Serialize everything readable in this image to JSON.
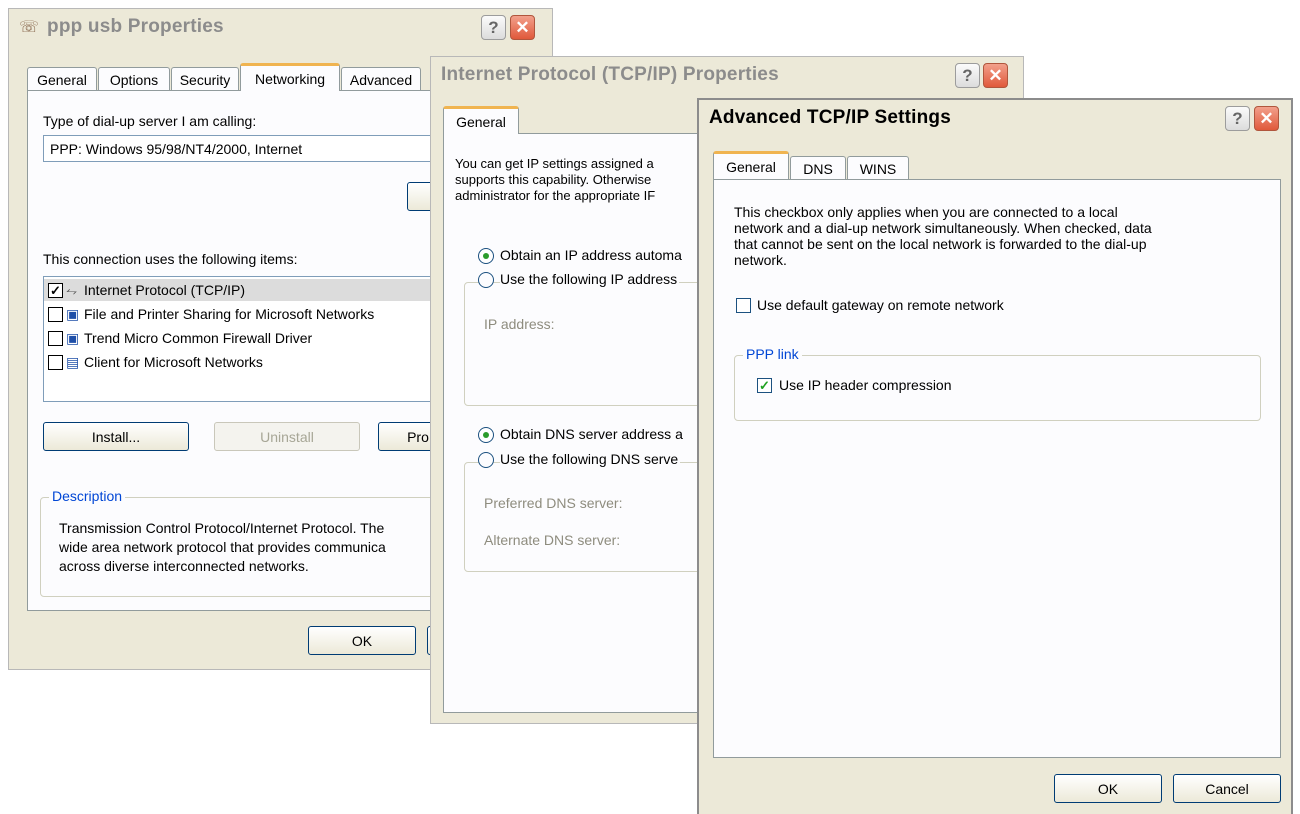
{
  "ppp_dialog": {
    "title": "ppp usb Properties",
    "tabs": [
      "General",
      "Options",
      "Security",
      "Networking",
      "Advanced"
    ],
    "active_tab": "Networking",
    "server_type_label": "Type of dial-up server I am calling:",
    "server_type_value": "PPP: Windows 95/98/NT4/2000, Internet",
    "items_label": "This connection uses the following items:",
    "items": [
      {
        "label": "Internet Protocol (TCP/IP)",
        "checked": true,
        "icon": "network-protocol-icon",
        "selected": true
      },
      {
        "label": "File and Printer Sharing for Microsoft Networks",
        "checked": false,
        "icon": "computer-icon"
      },
      {
        "label": "Trend Micro Common Firewall Driver",
        "checked": false,
        "icon": "computer-icon"
      },
      {
        "label": "Client for Microsoft Networks",
        "checked": false,
        "icon": "monitor-icon"
      }
    ],
    "install_label": "Install...",
    "uninstall_label": "Uninstall",
    "properties_label": "Pro",
    "description_legend": "Description",
    "description_lines": [
      "Transmission Control Protocol/Internet Protocol. The",
      "wide area network protocol that provides communica",
      "across diverse interconnected networks."
    ],
    "ok_label": "OK"
  },
  "tcpip_dialog": {
    "title": "Internet Protocol (TCP/IP) Properties",
    "tab": "General",
    "intro_lines": [
      "You can get IP settings assigned a",
      "supports this capability. Otherwise",
      "administrator for the appropriate IF"
    ],
    "obtain_ip_label": "Obtain an IP address automa",
    "use_ip_label": "Use the following IP address",
    "ip_address_label": "IP address:",
    "obtain_dns_label": "Obtain DNS server address a",
    "use_dns_label": "Use the following DNS serve",
    "preferred_dns_label": "Preferred DNS server:",
    "alternate_dns_label": "Alternate DNS server:"
  },
  "advanced_dialog": {
    "title": "Advanced TCP/IP Settings",
    "tabs": [
      "General",
      "DNS",
      "WINS"
    ],
    "active_tab": "General",
    "info_lines": [
      "This checkbox only applies when you are connected to a local",
      "network and a dial-up network simultaneously.  When checked, data",
      "that cannot be sent on the local network is forwarded to the dial-up",
      "network."
    ],
    "default_gateway_label": "Use default gateway on remote network",
    "default_gateway_checked": false,
    "ppp_link_legend": "PPP link",
    "ip_header_compression_label": "Use IP header compression",
    "ip_header_compression_checked": true,
    "ok_label": "OK",
    "cancel_label": "Cancel"
  },
  "colors": {
    "dialog_face": "#ece9d8",
    "panel_face": "#fcfcfe",
    "title_active": "#000000",
    "title_inactive": "#8c8c8c",
    "close_button": "#e0593b",
    "tab_highlight": "#f0b450",
    "groupbox_legend": "#0046d5",
    "check_green": "#21a121"
  }
}
